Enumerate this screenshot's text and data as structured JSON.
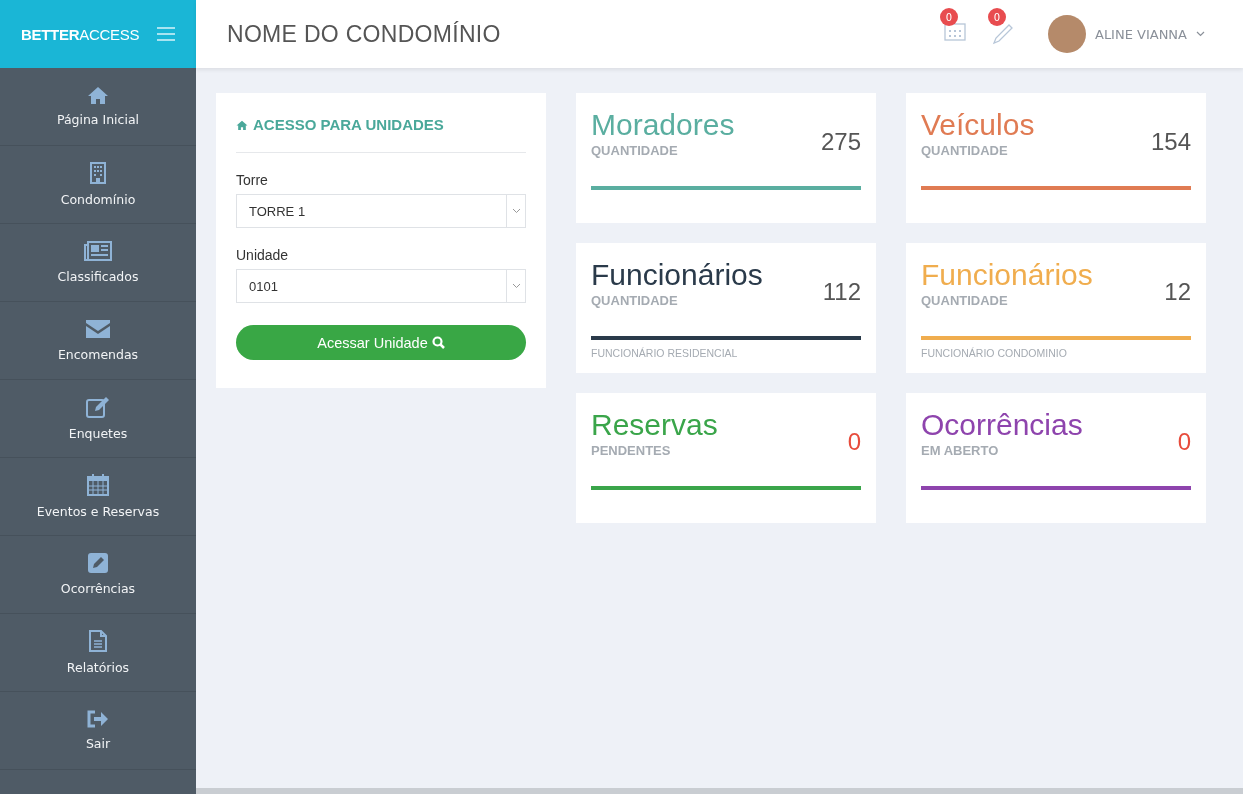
{
  "brand": {
    "bold": "BETTER",
    "rest": "ACCESS"
  },
  "header": {
    "title": "NOME DO CONDOMÍNIO",
    "notifications": [
      {
        "count": "0"
      },
      {
        "count": "0"
      }
    ],
    "user": {
      "name": "ALINE VIANNA"
    }
  },
  "sidebar": {
    "items": [
      {
        "label": "Página Inicial"
      },
      {
        "label": "Condomínio"
      },
      {
        "label": "Classificados"
      },
      {
        "label": "Encomendas"
      },
      {
        "label": "Enquetes"
      },
      {
        "label": "Eventos e Reservas"
      },
      {
        "label": "Ocorrências"
      },
      {
        "label": "Relatórios"
      },
      {
        "label": "Sair"
      }
    ]
  },
  "access_panel": {
    "title": "ACESSO PARA UNIDADES",
    "fields": [
      {
        "label": "Torre",
        "value": "TORRE 1"
      },
      {
        "label": "Unidade",
        "value": "0101"
      }
    ],
    "button": "Acessar Unidade"
  },
  "stats": [
    {
      "title": "Moradores",
      "subtitle": "QUANTIDADE",
      "value": "275",
      "color": "#5aaea0",
      "alert": false
    },
    {
      "title": "Veículos",
      "subtitle": "QUANTIDADE",
      "value": "154",
      "color": "#e07b53",
      "alert": false
    },
    {
      "title": "Funcionários",
      "subtitle": "QUANTIDADE",
      "value": "112",
      "color": "#2a3a4a",
      "alert": false,
      "footer": "FUNCIONÁRIO RESIDENCIAL"
    },
    {
      "title": "Funcionários",
      "subtitle": "QUANTIDADE",
      "value": "12",
      "color": "#f0ad4e",
      "alert": false,
      "footer": "FUNCIONÁRIO CONDOMINIO"
    },
    {
      "title": "Reservas",
      "subtitle": "PENDENTES",
      "value": "0",
      "color": "#3aa54a",
      "alert": true
    },
    {
      "title": "Ocorrências",
      "subtitle": "EM ABERTO",
      "value": "0",
      "color": "#8e44ad",
      "alert": true
    }
  ]
}
